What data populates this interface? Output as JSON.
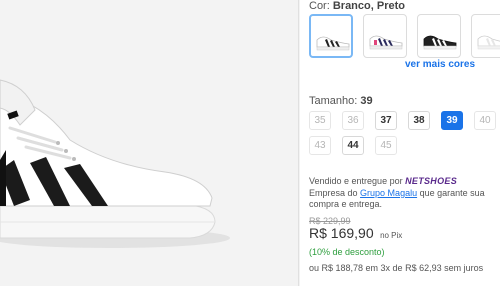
{
  "product_image": {
    "icon": "sneaker-image",
    "colors": {
      "upper": "#ffffff",
      "stripes": "#1b1b1b",
      "sole": "#f2f2f2"
    }
  },
  "color_selector": {
    "label": "Cor:",
    "value": "Branco, Preto",
    "swatches": [
      {
        "name": "white-black-sneaker",
        "selected": true
      },
      {
        "name": "white-pink-sneaker",
        "selected": false
      },
      {
        "name": "black-white-sneaker",
        "selected": false
      },
      {
        "name": "white-sneaker",
        "selected": false
      }
    ],
    "more_colors": "ver mais cores"
  },
  "size_selector": {
    "label": "Tamanho:",
    "value": "39",
    "sizes": [
      {
        "label": "35",
        "state": "unavailable"
      },
      {
        "label": "36",
        "state": "unavailable"
      },
      {
        "label": "37",
        "state": "available"
      },
      {
        "label": "38",
        "state": "available"
      },
      {
        "label": "39",
        "state": "selected"
      },
      {
        "label": "40",
        "state": "unavailable"
      },
      {
        "label": "43",
        "state": "unavailable"
      },
      {
        "label": "44",
        "state": "available"
      },
      {
        "label": "45",
        "state": "unavailable"
      }
    ]
  },
  "seller": {
    "prefix": "Vendido e entregue por",
    "brand": "NETSHOES",
    "company_text_1": "Empresa do",
    "company_link": "Grupo Magalu",
    "company_text_2": "que garante sua compra e entrega."
  },
  "pricing": {
    "old_price": "R$ 229,99",
    "price": "R$ 169,90",
    "price_suffix": "no Pix",
    "discount": "(10% de desconto)",
    "installments": "ou R$ 188,78 em 3x de R$ 62,93 sem juros"
  },
  "colors": {
    "accent": "#1a73e8",
    "discount": "#2e9e3e",
    "brand": "#5a2a8c"
  }
}
